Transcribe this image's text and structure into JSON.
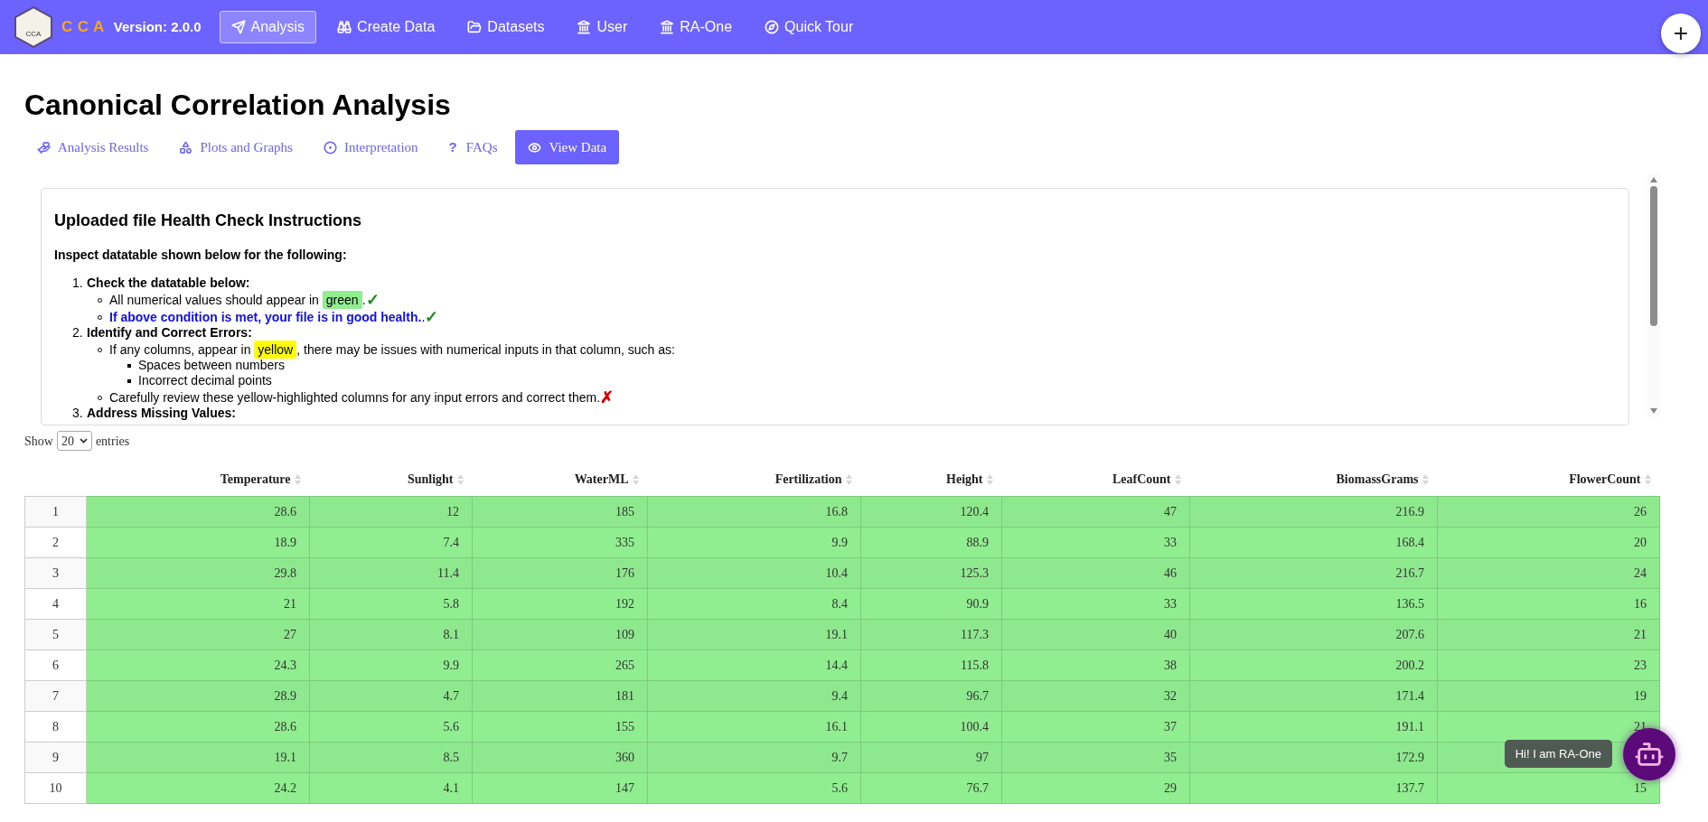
{
  "navbar": {
    "logo_text": "CCA",
    "brand": "C C A",
    "version": "Version: 2.0.0",
    "items": [
      {
        "label": "Analysis",
        "selected": true
      },
      {
        "label": "Create Data",
        "selected": false
      },
      {
        "label": "Datasets",
        "selected": false
      },
      {
        "label": "User",
        "selected": false
      },
      {
        "label": "RA-One",
        "selected": false
      },
      {
        "label": "Quick Tour",
        "selected": false
      }
    ]
  },
  "fab": {
    "label": "+"
  },
  "page_title": "Canonical Correlation Analysis",
  "tabs": [
    {
      "label": "Analysis Results",
      "selected": false
    },
    {
      "label": "Plots and Graphs",
      "selected": false
    },
    {
      "label": "Interpretation",
      "selected": false
    },
    {
      "label": "FAQs",
      "icon_text": "?",
      "selected": false
    },
    {
      "label": "View Data",
      "selected": true
    }
  ],
  "instructions": {
    "title": "Uploaded file Health Check Instructions",
    "lead": "Inspect datatable shown below for the following:",
    "steps": [
      {
        "number": "1.",
        "heading": "Check the datatable below:",
        "bullets": [
          {
            "parts": [
              {
                "text": "All numerical values should appear in "
              },
              {
                "text": "green",
                "color": "#90ee90"
              },
              {
                "text": ". "
              }
            ],
            "mark": {
              "text": "✓",
              "kind": "check"
            }
          },
          {
            "parts": [
              {
                "text": "If above condition is met, your file is in good health.",
                "emphasis": true
              },
              {
                "text": ". "
              }
            ],
            "mark": {
              "text": "✓",
              "kind": "check"
            }
          }
        ]
      },
      {
        "number": "2.",
        "heading": "Identify and Correct Errors:",
        "bullets": [
          {
            "parts": [
              {
                "text": "If any columns, appear in "
              },
              {
                "text": "yellow",
                "color": "#ffff00"
              },
              {
                "text": ", there may be issues with numerical inputs in that column, such as:"
              }
            ],
            "sub": [
              "Spaces between numbers",
              "Incorrect decimal points"
            ]
          },
          {
            "parts": [
              {
                "text": "Carefully review these yellow-highlighted columns for any input errors and correct them. "
              }
            ],
            "mark": {
              "text": "✗",
              "kind": "cross"
            }
          }
        ]
      },
      {
        "number": "3.",
        "heading": "Address Missing Values:"
      }
    ]
  },
  "length_menu": {
    "before": "Show",
    "value": "20",
    "after": "entries"
  },
  "table": {
    "columns": [
      {
        "label": "Temperature",
        "flagged": false
      },
      {
        "label": "Sunlight",
        "flagged": false
      },
      {
        "label": "WaterML",
        "flagged": false
      },
      {
        "label": "Fertilization",
        "flagged": false
      },
      {
        "label": "Height",
        "flagged": false
      },
      {
        "label": "LeafCount",
        "flagged": false
      },
      {
        "label": "BiomassGrams",
        "flagged": false
      },
      {
        "label": "FlowerCount",
        "flagged": false
      }
    ],
    "rows": [
      {
        "index": "1",
        "cells": [
          "28.6",
          "12",
          "185",
          "16.8",
          "120.4",
          "47",
          "216.9",
          "26"
        ]
      },
      {
        "index": "2",
        "cells": [
          "18.9",
          "7.4",
          "335",
          "9.9",
          "88.9",
          "33",
          "168.4",
          "20"
        ]
      },
      {
        "index": "3",
        "cells": [
          "29.8",
          "11.4",
          "176",
          "10.4",
          "125.3",
          "46",
          "216.7",
          "24"
        ]
      },
      {
        "index": "4",
        "cells": [
          "21",
          "5.8",
          "192",
          "8.4",
          "90.9",
          "33",
          "136.5",
          "16"
        ]
      },
      {
        "index": "5",
        "cells": [
          "27",
          "8.1",
          "109",
          "19.1",
          "117.3",
          "40",
          "207.6",
          "21"
        ]
      },
      {
        "index": "6",
        "cells": [
          "24.3",
          "9.9",
          "265",
          "14.4",
          "115.8",
          "38",
          "200.2",
          "23"
        ]
      },
      {
        "index": "7",
        "cells": [
          "28.9",
          "4.7",
          "181",
          "9.4",
          "96.7",
          "32",
          "171.4",
          "19"
        ]
      },
      {
        "index": "8",
        "cells": [
          "28.6",
          "5.6",
          "155",
          "16.1",
          "100.4",
          "37",
          "191.1",
          "21"
        ]
      },
      {
        "index": "9",
        "cells": [
          "19.1",
          "8.5",
          "360",
          "9.7",
          "97",
          "35",
          "172.9"
        ]
      },
      {
        "index": "10",
        "cells": [
          "24.2",
          "4.1",
          "147",
          "5.6",
          "76.7",
          "29",
          "137.7",
          "15"
        ]
      }
    ]
  },
  "chat": {
    "greeting": "Hi! I am RA-One"
  }
}
